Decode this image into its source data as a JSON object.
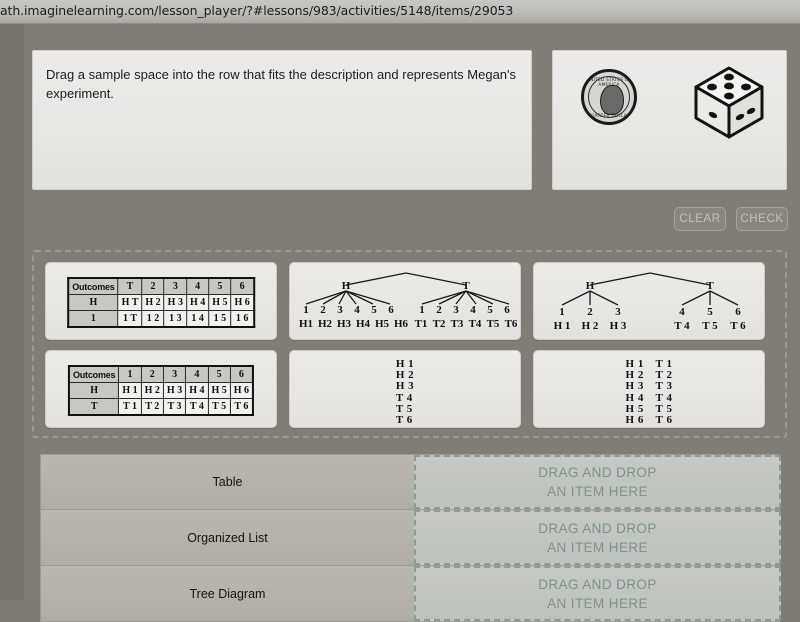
{
  "browser": {
    "url": "ath.imaginelearning.com/lesson_player/?#lessons/983/activities/5148/items/29053"
  },
  "prompt": {
    "text": "Drag a sample space into the row that fits the description and represents Megan's experiment."
  },
  "stimulus": {
    "coin_icon": "coin-quarter-icon",
    "coin_legend_top": "UNITED STATES OF AMERICA",
    "coin_legend_bottom": "QUARTER DOLLAR",
    "die_icon": "six-sided-die-icon"
  },
  "toolbar": {
    "clear_label": "CLEAR",
    "check_label": "CHECK"
  },
  "options": {
    "table_1": {
      "kind": "table",
      "header": [
        "Outcomes",
        "T",
        "2",
        "3",
        "4",
        "5",
        "6"
      ],
      "rows": [
        [
          "H",
          "H T",
          "H 2",
          "H 3",
          "H 4",
          "H 5",
          "H 6"
        ],
        [
          "1",
          "1 T",
          "1 2",
          "1 3",
          "1 4",
          "1 5",
          "1 6"
        ]
      ]
    },
    "table_2": {
      "kind": "table",
      "header": [
        "Outcomes",
        "1",
        "2",
        "3",
        "4",
        "5",
        "6"
      ],
      "rows": [
        [
          "H",
          "H 1",
          "H 2",
          "H 3",
          "H 4",
          "H 5",
          "H 6"
        ],
        [
          "T",
          "T 1",
          "T 2",
          "T 3",
          "T 4",
          "T 5",
          "T 6"
        ]
      ]
    },
    "tree_1": {
      "kind": "tree",
      "branch_left_label": "H",
      "branch_right_label": "T",
      "left_children": [
        "1",
        "2",
        "3",
        "4",
        "5",
        "6"
      ],
      "right_children": [
        "1",
        "2",
        "3",
        "4",
        "5",
        "6"
      ],
      "left_outcomes": [
        "H1",
        "H2",
        "H3",
        "H4",
        "H5",
        "H6"
      ],
      "right_outcomes": [
        "T1",
        "T2",
        "T3",
        "T4",
        "T5",
        "T6"
      ]
    },
    "tree_2": {
      "kind": "tree",
      "branch_left_label": "H",
      "branch_right_label": "T",
      "left_children": [
        "1",
        "2",
        "3"
      ],
      "right_children": [
        "4",
        "5",
        "6"
      ],
      "left_outcomes": [
        "H 1",
        "H 2",
        "H 3"
      ],
      "right_outcomes": [
        "T 4",
        "T 5",
        "T 6"
      ]
    },
    "list_1": {
      "kind": "list",
      "column_1": [
        "H 1",
        "H 2",
        "H 3",
        "T 4",
        "T 5",
        "T 6"
      ],
      "column_2": []
    },
    "list_2": {
      "kind": "list",
      "column_1": [
        "H 1",
        "H 2",
        "H 3",
        "H 4",
        "H 5",
        "H 6"
      ],
      "column_2": [
        "T 1",
        "T 2",
        "T 3",
        "T 4",
        "T 5",
        "T 6"
      ]
    }
  },
  "answer_rows": [
    {
      "label": "Table",
      "drop_line_1": "DRAG AND DROP",
      "drop_line_2": "AN ITEM HERE"
    },
    {
      "label": "Organized List",
      "drop_line_1": "DRAG AND DROP",
      "drop_line_2": "AN ITEM HERE"
    },
    {
      "label": "Tree Diagram",
      "drop_line_1": "DRAG AND DROP",
      "drop_line_2": "AN ITEM HERE"
    }
  ],
  "colors": {
    "page_background": "#7d7b74",
    "panel_background": "#eceae7",
    "drop_zone_text": "#7d918d",
    "drop_zone_background": "#c4c8c3",
    "row_label_background": "#b6b4ad"
  }
}
